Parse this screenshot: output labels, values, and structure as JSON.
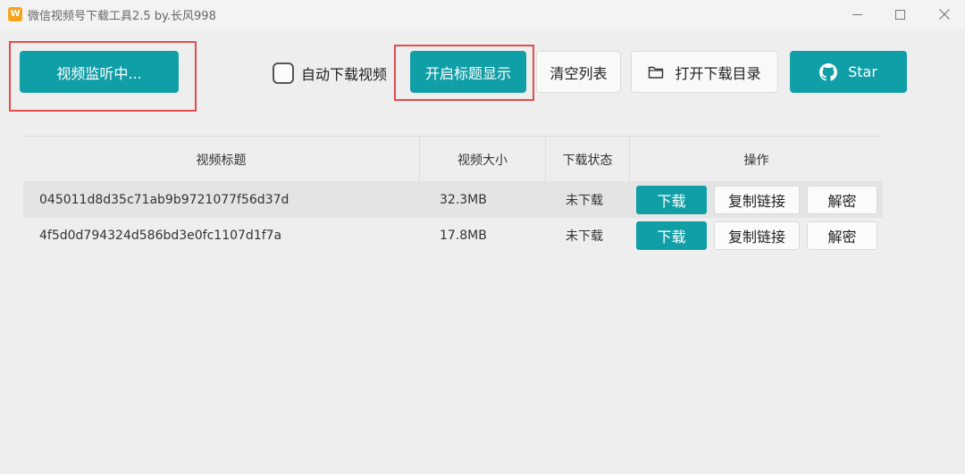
{
  "window": {
    "title": "微信视频号下载工具2.5 by.长风998",
    "app_icon": "W"
  },
  "toolbar": {
    "monitor_label": "视频监听中...",
    "auto_download_label": "自动下载视频",
    "auto_download_checked": false,
    "title_display_label": "开启标题显示",
    "clear_list_label": "清空列表",
    "open_dir_label": "打开下载目录",
    "star_label": "Star"
  },
  "table": {
    "headers": {
      "title": "视频标题",
      "size": "视频大小",
      "status": "下载状态",
      "actions": "操作"
    },
    "rows": [
      {
        "title": "045011d8d35c71ab9b9721077f56d37d",
        "size": "32.3MB",
        "status": "未下载",
        "download": "下载",
        "copy_link": "复制链接",
        "decrypt": "解密"
      },
      {
        "title": "4f5d0d794324d586bd3e0fc1107d1f7a",
        "size": "17.8MB",
        "status": "未下载",
        "download": "下载",
        "copy_link": "复制链接",
        "decrypt": "解密"
      }
    ]
  },
  "colors": {
    "accent": "#119fa7",
    "highlight": "#e64b4b",
    "background": "#eeeeee"
  },
  "icons": {
    "app": "app-logo-icon",
    "folder": "folder-icon",
    "github": "github-icon",
    "minimize": "minimize-icon",
    "maximize": "maximize-icon",
    "close": "close-icon"
  }
}
